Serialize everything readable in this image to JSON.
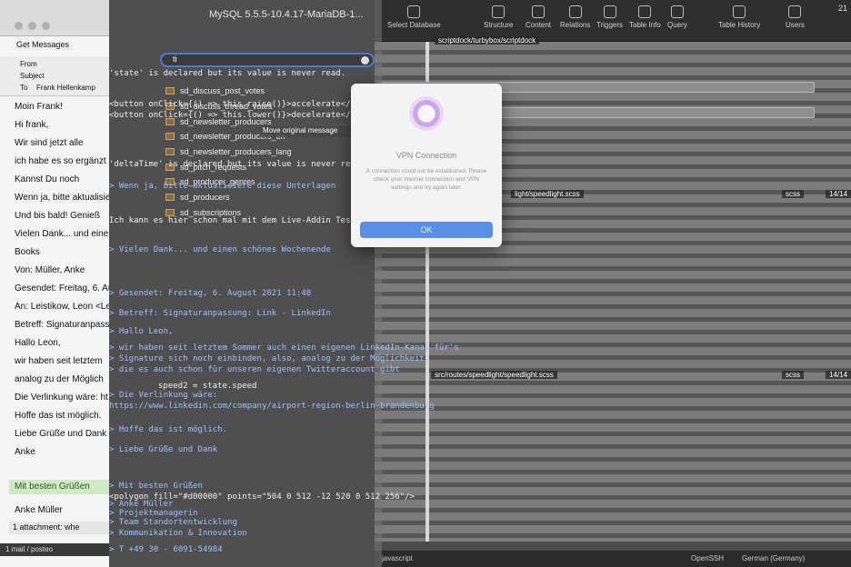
{
  "mail": {
    "get_messages": "Get Messages",
    "header": {
      "from_label": "From",
      "subject_label": "Subject",
      "to_label": "To",
      "to_value": "Frank Hellenkamp"
    },
    "body_lines": [
      "Moin Frank!",
      "Hi frank,",
      "Wir sind jetzt alle",
      "ich habe es so ergänzt",
      "Kannst Du noch",
      "Wenn ja, bitte aktualisie",
      "Und bis bald! Genieß",
      "Vielen Dank... und einen",
      "Books",
      "Von: Müller, Anke",
      "Gesendet: Freitag, 6. Au",
      "An: Leistikow, Leon <Leo",
      "Betreff: Signaturanpass",
      "Hallo Leon,",
      "wir haben seit letztem",
      "analog zu der Möglich",
      "Die Verlinkung wäre: ht",
      "Hoffe das ist möglich.",
      "Liebe Grüße und Dank",
      "Anke"
    ],
    "greeting_highlight": "Mit besten Grüßen",
    "signature": "Anke Müller",
    "attachment": "1 attachment: whe",
    "status": "1 mail / posteo"
  },
  "sql": {
    "title": "MySQL 5.5.5-10.4.17-MariaDB-1...",
    "search_query": "ti",
    "copy_checkbox": "Move original message",
    "tables": [
      "sd_discuss_post_votes",
      "sd_discuss_thread_votes",
      "sd_newsletter_producers",
      "sd_newsletter_producers_en",
      "sd_newsletter_producers_lang",
      "sd_pitch_requests",
      "sd_producer_genres",
      "sd_producers",
      "sd_subscriptions"
    ]
  },
  "editor": {
    "lines": [
      "'state' is declared but its value is never read.",
      "<button onClick={() => this.raise()}>accelerate</button>",
      "<button onClick={() => this.lower()}>decelerate</button>",
      "'deltaTime' is declared but its value is never read.",
      "> Wenn ja, bitte aktualisiere diese Unterlagen",
      "Ich kann es hier schon mal mit dem Live-Addin Testen. Aber wenn es",
      "> Vielen Dank... und einen schönes Wochenende",
      "> Gesendet: Freitag, 6. August 2021 11:48",
      "> Betreff: Signaturanpassung: Link - LinkedIn",
      "> Hallo Leon,",
      "> wir haben seit letztem Sommer auch einen eigenen LinkedIn-Kanal für's",
      "> Signature sich noch einbinden, also, analog zu der Möglichkeit,",
      "> die es auch schon für unseren eigenen Twitteraccount gibt",
      "speed2 = state.speed",
      "> Die Verlinkung wäre:",
      "https://www.linkedin.com/company/airport-region-berlin-brandenburg",
      "> Hoffe das ist möglich.",
      "> Liebe Grüße und Dank",
      "<polygon fill=\"#d00000\" points=\"504 0 512 -12 520 0 512 256\"/>",
      "> Mit besten Grüßen",
      "> Anke Müller",
      "> Projektmanagerin",
      "> Team Standortentwicklung",
      "> Kommunikation & Innovation",
      "> T +49 30 - 6091-54984"
    ]
  },
  "right": {
    "toolbar": [
      "Select Database",
      "Structure",
      "Content",
      "Relations",
      "Triggers",
      "Table Info",
      "Query",
      "Table History",
      "Users"
    ],
    "path_top": "scriptdock/turbybox/scriptdock",
    "path_mid": "light/speedlight.scss",
    "path_low": "src/routes/speedlight/speedlight.scss",
    "file_tag": "scss",
    "counter_a": "14/14",
    "counter_b": "14/14",
    "status_left": "javascript",
    "status_right": "OpenSSH",
    "language": "German (Germany)",
    "time": "21"
  },
  "vpn": {
    "title": "VPN Connection",
    "message": "A connection could not be established. Please check your internet connection and VPN settings and try again later.",
    "ok_label": "OK"
  }
}
